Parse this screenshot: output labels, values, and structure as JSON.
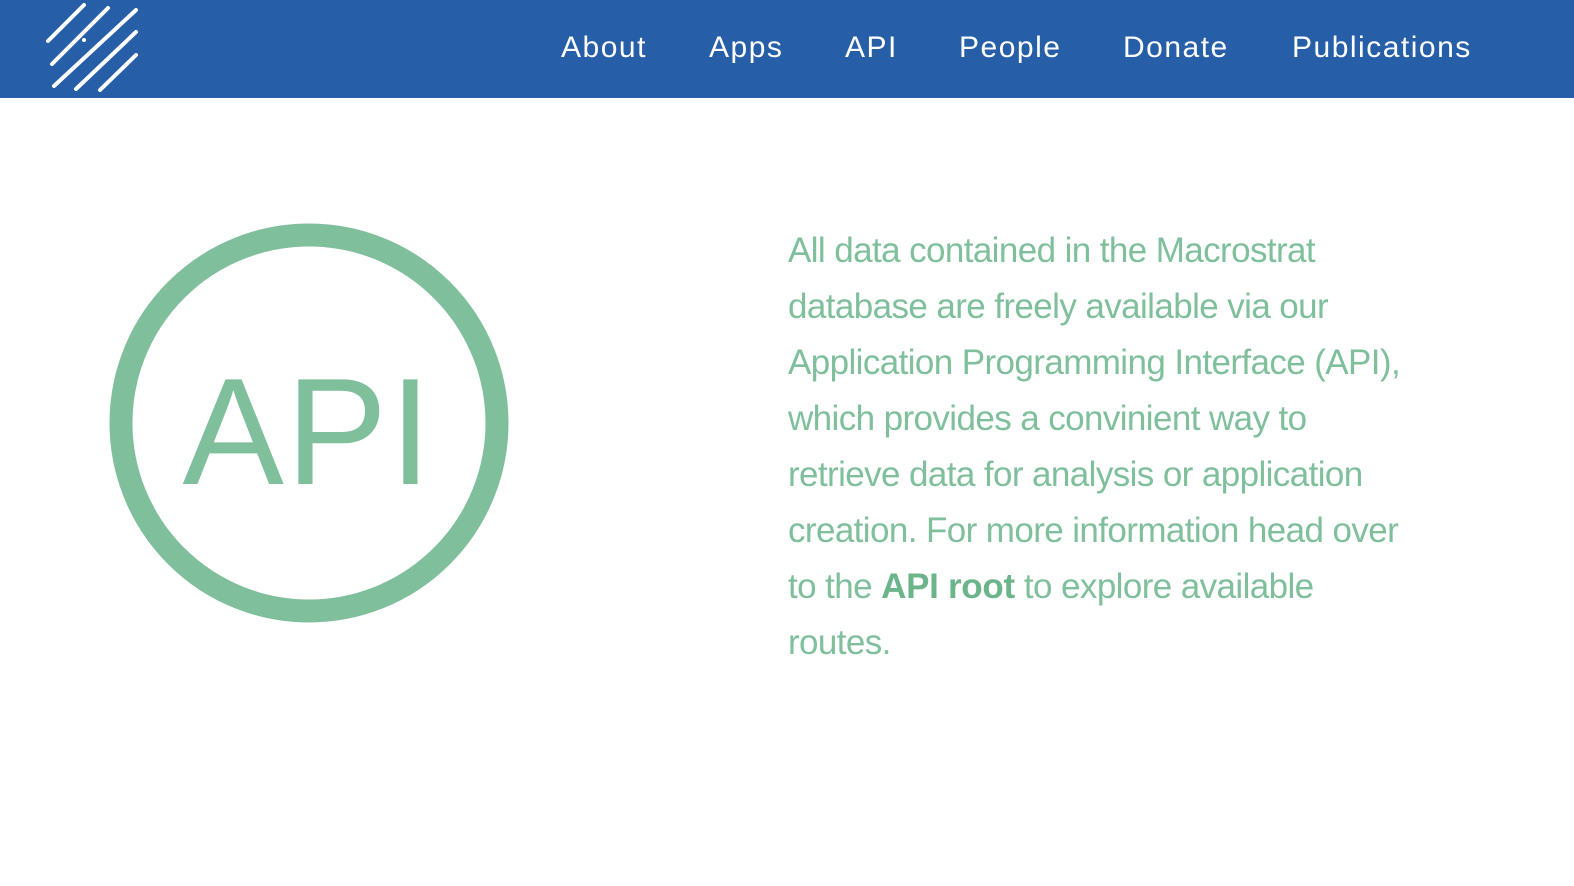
{
  "nav": {
    "logo_icon": "macrostrat-diagonal-lines-logo",
    "links": [
      {
        "label": "About"
      },
      {
        "label": "Apps"
      },
      {
        "label": "API"
      },
      {
        "label": "People"
      },
      {
        "label": "Donate"
      },
      {
        "label": "Publications"
      }
    ]
  },
  "badge": {
    "text": "API",
    "icon": "api-circle-badge"
  },
  "description": {
    "line1": "All data contained in the Macrostrat",
    "line2": "database are freely available via our",
    "line3": "Application Programming Interface (API),",
    "line4": "which provides a convinient way to",
    "line5": "retrieve data for analysis or application",
    "line6": "creation. For more information head over",
    "line7_before": "to the ",
    "line7_link": "API root",
    "line7_after": " to explore available",
    "line8": "routes."
  },
  "colors": {
    "navbar": "#265ea8",
    "accent_green": "#7fbf9b",
    "link_green": "#6cb58a",
    "background": "#ffffff"
  }
}
